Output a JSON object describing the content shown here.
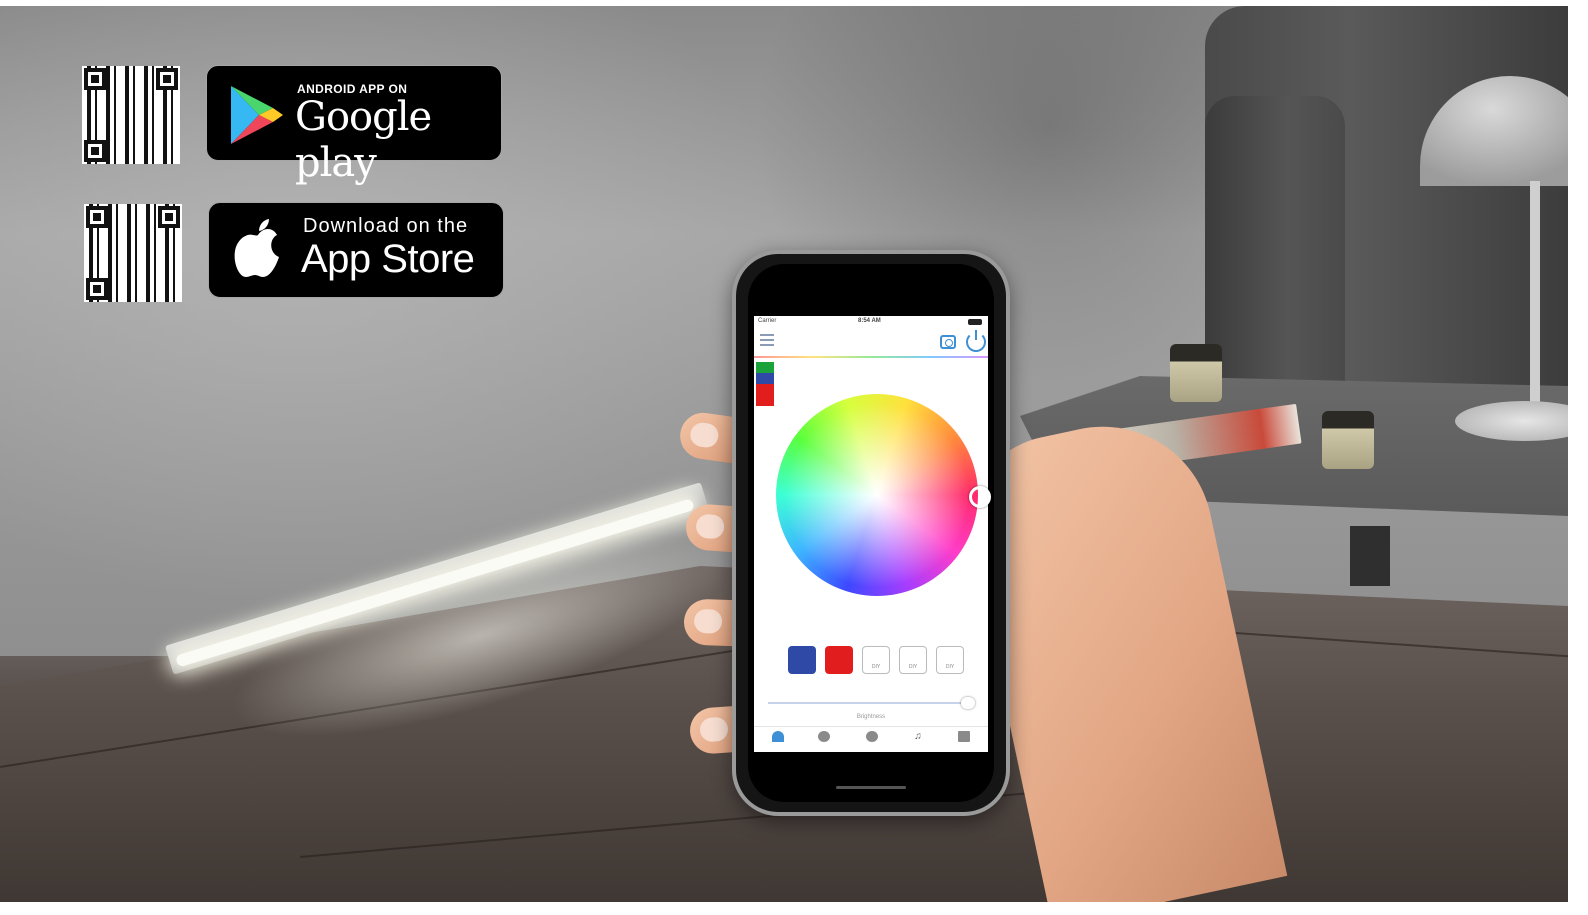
{
  "stores": {
    "google": {
      "small_label": "ANDROID APP ON",
      "big_label": "Google play"
    },
    "apple": {
      "small_label": "Download on the",
      "big_label": "App Store"
    }
  },
  "phone_app": {
    "preset_labels": [
      "DIY",
      "DIY",
      "DIY"
    ],
    "selected_color_swatches": [
      "#2f4aa6",
      "#e21d1d"
    ],
    "brightness_label": "Brightness",
    "brightness_level": 0.97,
    "tabs": [
      {
        "icon": "lamp-icon",
        "active": true
      },
      {
        "icon": "mode-icon",
        "active": false
      },
      {
        "icon": "mic-icon",
        "active": false
      },
      {
        "icon": "music-icon",
        "active": false
      },
      {
        "icon": "qr-icon",
        "active": false
      }
    ],
    "accent_color": "#3d8fd6"
  }
}
